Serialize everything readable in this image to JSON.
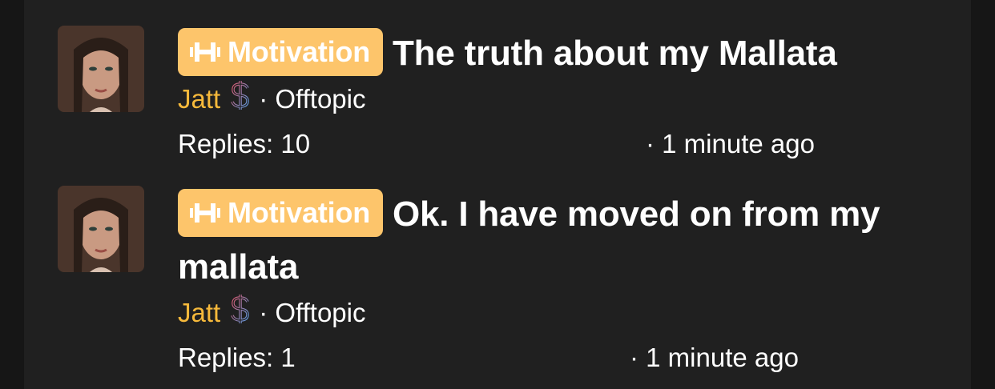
{
  "threads": [
    {
      "badge_label": "Motivation",
      "title": "The truth about my Mallata",
      "author": "Jatt",
      "forum": "· Offtopic",
      "replies": "Replies: 10",
      "time": "· 1 minute ago"
    },
    {
      "badge_label": "Motivation",
      "title": "Ok. I have moved on from my mallata",
      "author": "Jatt",
      "forum": "· Offtopic",
      "replies": "Replies: 1",
      "time": "· 1 minute ago"
    }
  ],
  "colors": {
    "badge": "#fdc56b",
    "author": "#f6b93b",
    "panel": "#202020",
    "background": "#161616"
  },
  "icons": {
    "badge": "dumbbell-icon",
    "author_flair": "dollar-icon"
  }
}
